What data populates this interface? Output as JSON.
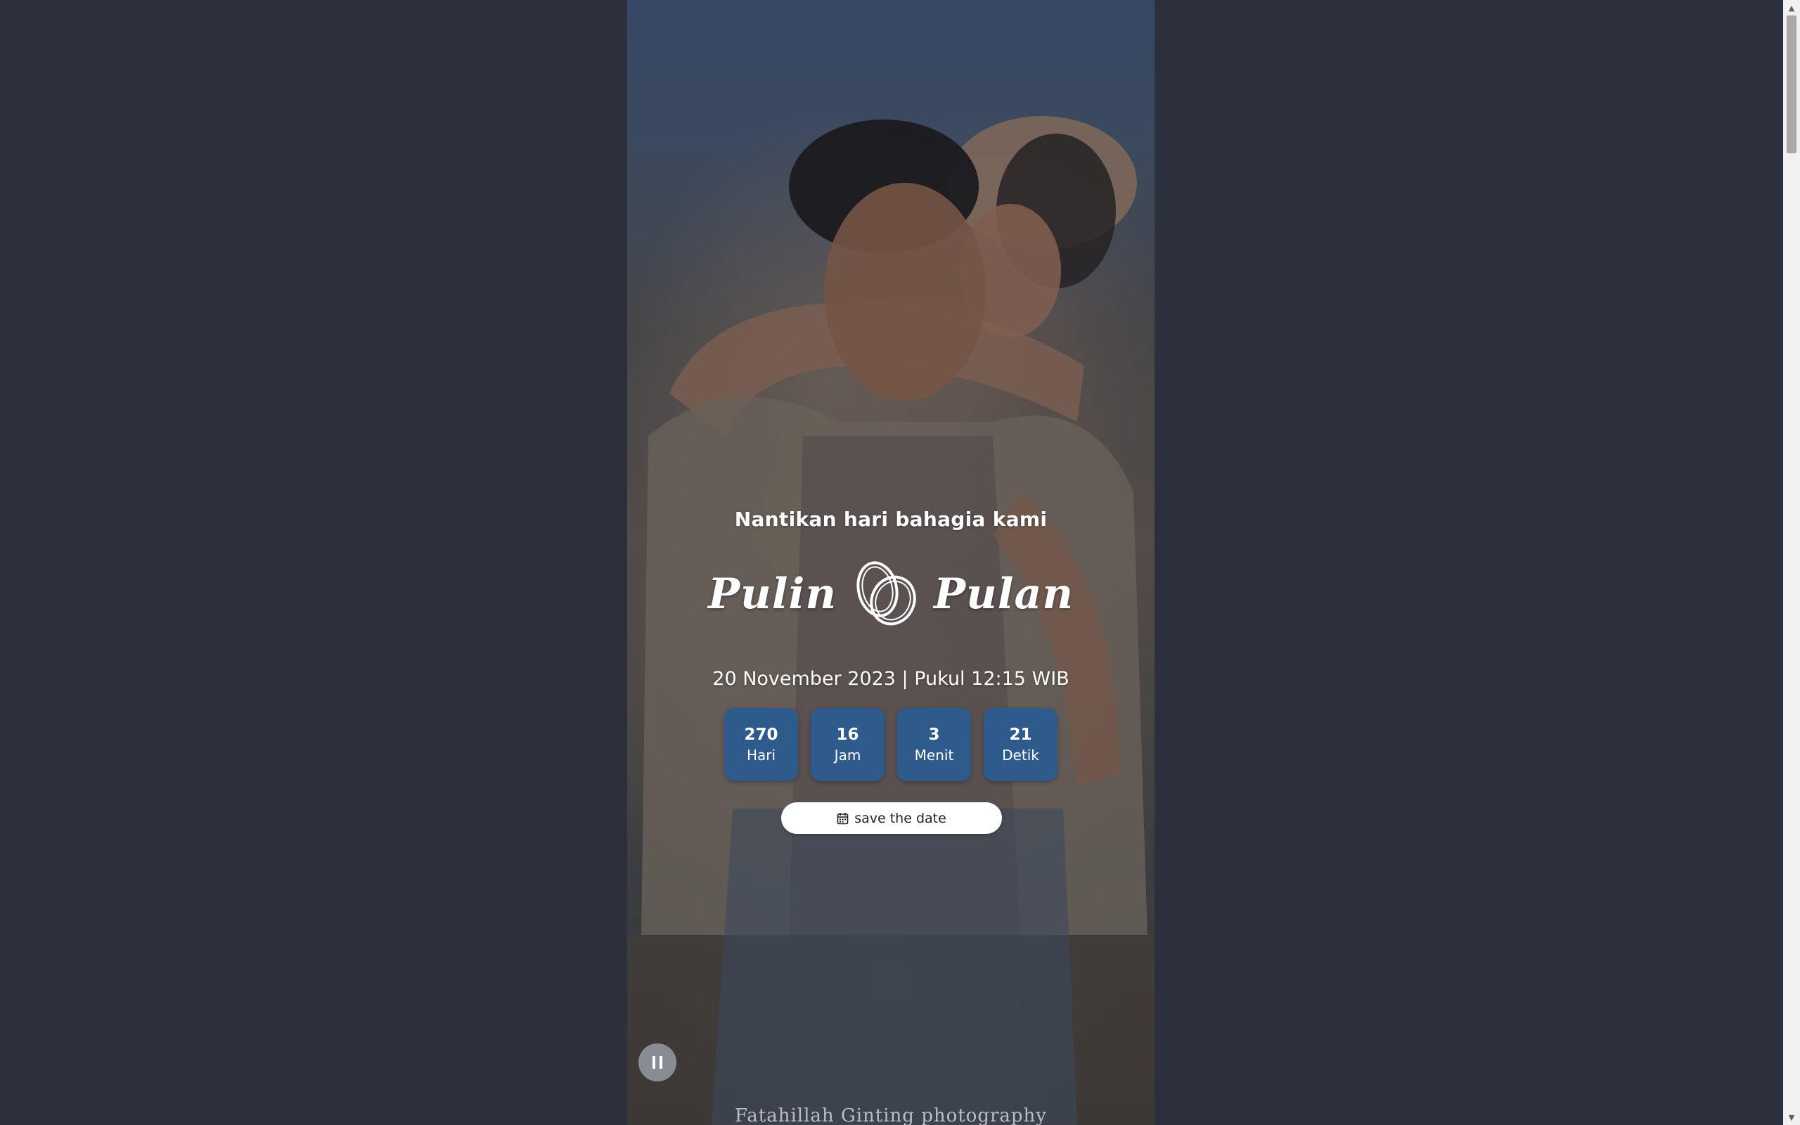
{
  "invitation": {
    "tagline": "Nantikan hari bahagia kami",
    "groom_name": "Pulin",
    "bride_name": "Pulan",
    "date_line": "20 November 2023 | Pukul 12:15 WIB",
    "countdown": [
      {
        "value": "270",
        "label": "Hari"
      },
      {
        "value": "16",
        "label": "Jam"
      },
      {
        "value": "3",
        "label": "Menit"
      },
      {
        "value": "21",
        "label": "Detik"
      }
    ],
    "save_button_label": "save the date",
    "watermark": "Fatahillah Ginting photography"
  },
  "icons": {
    "rings": "rings-icon",
    "calendar": "calendar-icon",
    "music_toggle": "pause-icon"
  },
  "colors": {
    "page_background": "#2c303c",
    "countdown_box": "#2f5a8c",
    "button_background": "#ffffff",
    "text": "#ffffff"
  }
}
